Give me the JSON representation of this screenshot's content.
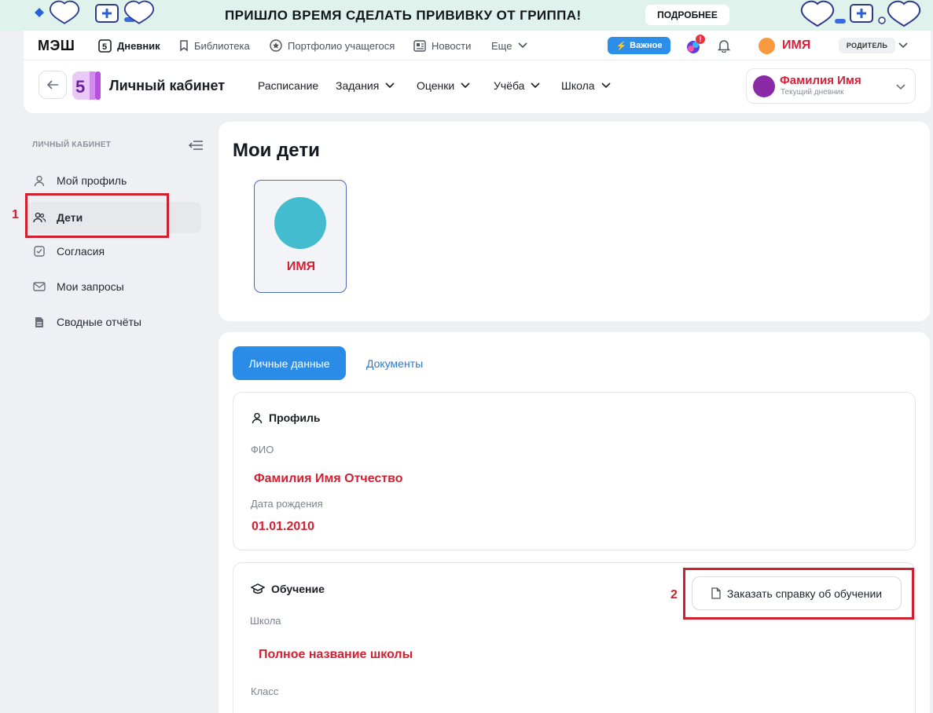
{
  "banner": {
    "text": "ПРИШЛО ВРЕМЯ СДЕЛАТЬ ПРИВИВКУ ОТ ГРИППА!",
    "button": "ПОДРОБНЕЕ"
  },
  "global_nav": {
    "logo": "МЭШ",
    "items": [
      {
        "label": "Дневник",
        "icon": "diary-5-icon"
      },
      {
        "label": "Библиотека",
        "icon": "bookmark-icon"
      },
      {
        "label": "Портфолио учащегося",
        "icon": "star-badge-icon"
      },
      {
        "label": "Новости",
        "icon": "newspaper-icon"
      },
      {
        "label": "Еще",
        "icon": "chevron-down-icon"
      }
    ],
    "important": "Важное",
    "notification_badge": "!",
    "user_name": "ИМЯ",
    "role": "РОДИТЕЛЬ"
  },
  "header": {
    "title": "Личный кабинет",
    "menu": [
      "Расписание",
      "Задания",
      "Оценки",
      "Учёба",
      "Школа"
    ],
    "diary_name": "Фамилия Имя",
    "diary_sub": "Текущий дневник"
  },
  "sidebar": {
    "heading": "ЛИЧНЫЙ КАБИНЕТ",
    "items": [
      {
        "label": "Мой профиль",
        "icon": "user-icon"
      },
      {
        "label": "Дети",
        "icon": "users-icon"
      },
      {
        "label": "Согласия",
        "icon": "checkbox-icon"
      },
      {
        "label": "Мои запросы",
        "icon": "mail-icon"
      },
      {
        "label": "Сводные отчёты",
        "icon": "document-icon"
      }
    ],
    "active_index": 1
  },
  "annotations": {
    "marker_1": "1",
    "marker_2": "2"
  },
  "main": {
    "title": "Мои дети",
    "child_name": "ИМЯ",
    "tabs": [
      "Личные данные",
      "Документы"
    ],
    "profile": {
      "title": "Профиль",
      "fio_label": "ФИО",
      "fio_value": "Фамилия Имя Отчество",
      "birth_label": "Дата рождения",
      "birth_value": "01.01.2010"
    },
    "education": {
      "title": "Обучение",
      "button": "Заказать справку об обучении",
      "school_label": "Школа",
      "school_value": "Полное название школы",
      "class_label": "Класс"
    }
  },
  "colors": {
    "accent_blue": "#2a8ce6",
    "highlight_red": "#cf2030",
    "banner_bg": "#dff3ec"
  }
}
